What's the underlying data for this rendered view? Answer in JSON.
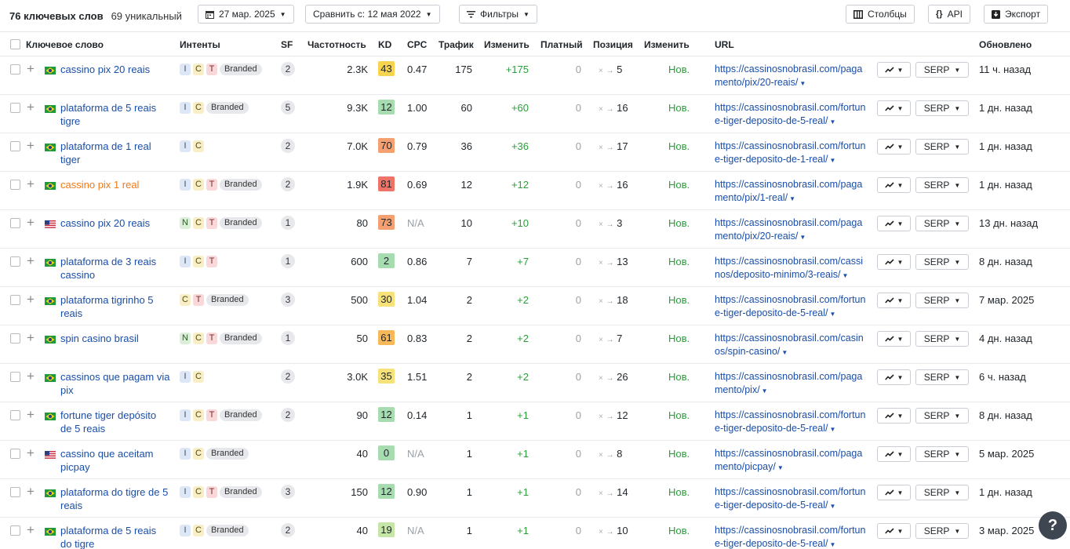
{
  "toolbar": {
    "keyword_count": "76 ключевых слов",
    "unique_count": "69 уникальный",
    "date_label": "27 мар. 2025",
    "compare_label": "Сравнить с: 12 мая 2022",
    "filters_label": "Фильтры",
    "columns_label": "Столбцы",
    "api_label": "API",
    "export_label": "Экспорт"
  },
  "columns": {
    "keyword": "Ключевое слово",
    "intents": "Интенты",
    "sf": "SF",
    "volume": "Частотность",
    "kd": "KD",
    "cpc": "CPC",
    "traffic": "Трафик",
    "change": "Изменить",
    "paid": "Платный",
    "position": "Позиция",
    "pos_change": "Изменить",
    "url": "URL",
    "updated": "Обновлено"
  },
  "rows": [
    {
      "flag": "br",
      "keyword": "cassino pix 20 reais",
      "intents": [
        "I",
        "C",
        "T",
        "Branded"
      ],
      "sf": "2",
      "volume": "2.3K",
      "kd": "43",
      "kd_color": "#f7d44f",
      "cpc": "0.47",
      "traffic": "175",
      "change": "+175",
      "paid": "0",
      "pos_from": "×",
      "pos_to": "5",
      "pos_change": "Нов.",
      "url": "https://cassinosnobrasil.com/pagamento/pix/20-reais/",
      "updated": "11 ч. назад"
    },
    {
      "flag": "br",
      "keyword": "plataforma de 5 reais tigre",
      "intents": [
        "I",
        "C",
        "Branded"
      ],
      "sf": "5",
      "volume": "9.3K",
      "kd": "12",
      "kd_color": "#a6dcb0",
      "cpc": "1.00",
      "traffic": "60",
      "change": "+60",
      "paid": "0",
      "pos_from": "×",
      "pos_to": "16",
      "pos_change": "Нов.",
      "url": "https://cassinosnobrasil.com/fortune-tiger-deposito-de-5-real/",
      "updated": "1 дн. назад"
    },
    {
      "flag": "br",
      "keyword": "plataforma de 1 real tiger",
      "intents": [
        "I",
        "C"
      ],
      "sf": "2",
      "volume": "7.0K",
      "kd": "70",
      "kd_color": "#f4a070",
      "cpc": "0.79",
      "traffic": "36",
      "change": "+36",
      "paid": "0",
      "pos_from": "×",
      "pos_to": "17",
      "pos_change": "Нов.",
      "url": "https://cassinosnobrasil.com/fortune-tiger-deposito-de-1-real/",
      "updated": "1 дн. назад"
    },
    {
      "flag": "br",
      "keyword": "cassino pix 1 real",
      "highlight": true,
      "intents": [
        "I",
        "C",
        "T",
        "Branded"
      ],
      "sf": "2",
      "volume": "1.9K",
      "kd": "81",
      "kd_color": "#ef7468",
      "cpc": "0.69",
      "traffic": "12",
      "change": "+12",
      "paid": "0",
      "pos_from": "×",
      "pos_to": "16",
      "pos_change": "Нов.",
      "url": "https://cassinosnobrasil.com/pagamento/pix/1-real/",
      "updated": "1 дн. назад"
    },
    {
      "flag": "us",
      "keyword": "cassino pix 20 reais",
      "intents": [
        "N",
        "C",
        "T",
        "Branded"
      ],
      "sf": "1",
      "volume": "80",
      "kd": "73",
      "kd_color": "#f4a070",
      "cpc": "N/A",
      "traffic": "10",
      "change": "+10",
      "paid": "0",
      "pos_from": "×",
      "pos_to": "3",
      "pos_change": "Нов.",
      "url": "https://cassinosnobrasil.com/pagamento/pix/20-reais/",
      "updated": "13 дн. назад"
    },
    {
      "flag": "br",
      "keyword": "plataforma de 3 reais cassino",
      "intents": [
        "I",
        "C",
        "T"
      ],
      "sf": "1",
      "volume": "600",
      "kd": "2",
      "kd_color": "#a6dcb0",
      "cpc": "0.86",
      "traffic": "7",
      "change": "+7",
      "paid": "0",
      "pos_from": "×",
      "pos_to": "13",
      "pos_change": "Нов.",
      "url": "https://cassinosnobrasil.com/cassinos/deposito-minimo/3-reais/",
      "updated": "8 дн. назад"
    },
    {
      "flag": "br",
      "keyword": "plataforma tigrinho 5 reais",
      "intents": [
        "C",
        "T",
        "Branded"
      ],
      "sf": "3",
      "volume": "500",
      "kd": "30",
      "kd_color": "#f7e27a",
      "cpc": "1.04",
      "traffic": "2",
      "change": "+2",
      "paid": "0",
      "pos_from": "×",
      "pos_to": "18",
      "pos_change": "Нов.",
      "url": "https://cassinosnobrasil.com/fortune-tiger-deposito-de-5-real/",
      "updated": "7 мар. 2025"
    },
    {
      "flag": "br",
      "keyword": "spin casino brasil",
      "intents": [
        "N",
        "C",
        "T",
        "Branded"
      ],
      "sf": "1",
      "volume": "50",
      "kd": "61",
      "kd_color": "#f7b85a",
      "cpc": "0.83",
      "traffic": "2",
      "change": "+2",
      "paid": "0",
      "pos_from": "×",
      "pos_to": "7",
      "pos_change": "Нов.",
      "url": "https://cassinosnobrasil.com/casinos/spin-casino/",
      "updated": "4 дн. назад"
    },
    {
      "flag": "br",
      "keyword": "cassinos que pagam via pix",
      "intents": [
        "I",
        "C"
      ],
      "sf": "2",
      "volume": "3.0K",
      "kd": "35",
      "kd_color": "#f7e27a",
      "cpc": "1.51",
      "traffic": "2",
      "change": "+2",
      "paid": "0",
      "pos_from": "×",
      "pos_to": "26",
      "pos_change": "Нов.",
      "url": "https://cassinosnobrasil.com/pagamento/pix/",
      "updated": "6 ч. назад"
    },
    {
      "flag": "br",
      "keyword": "fortune tiger depósito de 5 reais",
      "intents": [
        "I",
        "C",
        "T",
        "Branded"
      ],
      "sf": "2",
      "volume": "90",
      "kd": "12",
      "kd_color": "#a6dcb0",
      "cpc": "0.14",
      "traffic": "1",
      "change": "+1",
      "paid": "0",
      "pos_from": "×",
      "pos_to": "12",
      "pos_change": "Нов.",
      "url": "https://cassinosnobrasil.com/fortune-tiger-deposito-de-5-real/",
      "updated": "8 дн. назад"
    },
    {
      "flag": "us",
      "keyword": "cassino que aceitam picpay",
      "intents": [
        "I",
        "C",
        "Branded"
      ],
      "sf": "",
      "volume": "40",
      "kd": "0",
      "kd_color": "#a6dcb0",
      "cpc": "N/A",
      "traffic": "1",
      "change": "+1",
      "paid": "0",
      "pos_from": "×",
      "pos_to": "8",
      "pos_change": "Нов.",
      "url": "https://cassinosnobrasil.com/pagamento/picpay/",
      "updated": "5 мар. 2025"
    },
    {
      "flag": "br",
      "keyword": "plataforma do tigre de 5 reais",
      "intents": [
        "I",
        "C",
        "T",
        "Branded"
      ],
      "sf": "3",
      "volume": "150",
      "kd": "12",
      "kd_color": "#a6dcb0",
      "cpc": "0.90",
      "traffic": "1",
      "change": "+1",
      "paid": "0",
      "pos_from": "×",
      "pos_to": "14",
      "pos_change": "Нов.",
      "url": "https://cassinosnobrasil.com/fortune-tiger-deposito-de-5-real/",
      "updated": "1 дн. назад"
    },
    {
      "flag": "br",
      "keyword": "plataforma de 5 reais do tigre",
      "intents": [
        "I",
        "C",
        "Branded"
      ],
      "sf": "2",
      "volume": "40",
      "kd": "19",
      "kd_color": "#c6e6a8",
      "cpc": "N/A",
      "traffic": "1",
      "change": "+1",
      "paid": "0",
      "pos_from": "×",
      "pos_to": "10",
      "pos_change": "Нов.",
      "url": "https://cassinosnobrasil.com/fortune-tiger-deposito-de-5-real/",
      "updated": "3 мар. 2025"
    }
  ],
  "row_controls": {
    "serp_label": "SERP"
  },
  "help_label": "?"
}
